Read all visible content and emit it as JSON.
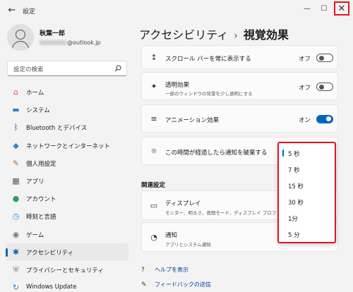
{
  "window": {
    "title": "設定",
    "back_icon": "←",
    "minimize_icon": "—",
    "maximize_icon": "☐",
    "close_icon": "✕"
  },
  "user": {
    "name": "秋葉一郎",
    "email_suffix": "@outlook.jp"
  },
  "search": {
    "placeholder": "設定の検索"
  },
  "sidebar": {
    "items": [
      {
        "label": "ホーム",
        "icon": "home-icon",
        "glyph": "⌂",
        "color": "#d4553d"
      },
      {
        "label": "システム",
        "icon": "system-icon",
        "glyph": "▬",
        "color": "#2b88d8"
      },
      {
        "label": "Bluetooth とデバイス",
        "icon": "bluetooth-icon",
        "glyph": "ᛒ",
        "color": "#0067c0"
      },
      {
        "label": "ネットワークとインターネット",
        "icon": "network-icon",
        "glyph": "◆",
        "color": "#2b88d8"
      },
      {
        "label": "個人用設定",
        "icon": "personalization-icon",
        "glyph": "✎",
        "color": "#b06b2e"
      },
      {
        "label": "アプリ",
        "icon": "apps-icon",
        "glyph": "▦",
        "color": "#555555"
      },
      {
        "label": "アカウント",
        "icon": "accounts-icon",
        "glyph": "●",
        "color": "#2e9e5e"
      },
      {
        "label": "時刻と言語",
        "icon": "time-language-icon",
        "glyph": "◷",
        "color": "#2b88d8"
      },
      {
        "label": "ゲーム",
        "icon": "gaming-icon",
        "glyph": "◉",
        "color": "#777777"
      },
      {
        "label": "アクセシビリティ",
        "icon": "accessibility-icon",
        "glyph": "✱",
        "color": "#0067c0",
        "active": true
      },
      {
        "label": "プライバシーとセキュリティ",
        "icon": "shield-icon",
        "glyph": "⛨",
        "color": "#777777"
      },
      {
        "label": "Windows Update",
        "icon": "windows-update-icon",
        "glyph": "↻",
        "color": "#2b88d8"
      }
    ]
  },
  "breadcrumb": {
    "parent": "アクセシビリティ",
    "separator": "›",
    "current": "視覚効果"
  },
  "settings": {
    "scrollbars": {
      "title": "スクロール バーを常に表示する",
      "state": "オフ",
      "on": false
    },
    "transparency": {
      "title": "透明効果",
      "subtitle": "一部のウィンドウの背景を少し透明にする",
      "state": "オフ",
      "on": false
    },
    "animation": {
      "title": "アニメーション効果",
      "state": "オン",
      "on": true
    },
    "dismiss": {
      "title": "この時間が経過したら通知を破棄する"
    }
  },
  "related": {
    "heading": "関連設定",
    "display": {
      "title": "ディスプレイ",
      "subtitle": "モニター、明るさ、夜間モード、ディスプレイ プロファイル"
    },
    "notifications": {
      "title": "通知",
      "subtitle": "アプリとシステム通知"
    }
  },
  "footer": {
    "help": "ヘルプを表示",
    "feedback": "フィードバックの送信"
  },
  "dropdown": {
    "options": [
      "5 秒",
      "7 秒",
      "15 秒",
      "30 秒",
      "1分",
      "5 分"
    ],
    "selected": "5 秒",
    "highlight_color": "#e81123"
  },
  "colors": {
    "accent": "#0067c0",
    "annotation_red": "#e81123"
  }
}
